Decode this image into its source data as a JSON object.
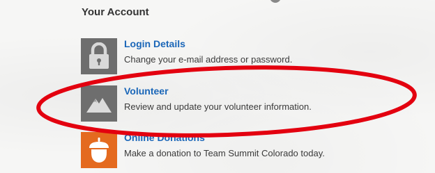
{
  "account": {
    "title": "Your Account",
    "items": [
      {
        "title": "Login Details",
        "description": "Change your e-mail address or password.",
        "icon": "lock-icon"
      },
      {
        "title": "Volunteer",
        "description": "Review and update your volunteer information.",
        "icon": "mountain-icon"
      },
      {
        "title": "Online Donations",
        "description": "Make a donation to Team Summit Colorado today.",
        "icon": "acorn-icon"
      }
    ]
  },
  "colors": {
    "link": "#1a66b8",
    "tile_gray": "#6e6e6e",
    "tile_orange": "#e46a1f",
    "annotation_ring": "#e3000f"
  }
}
